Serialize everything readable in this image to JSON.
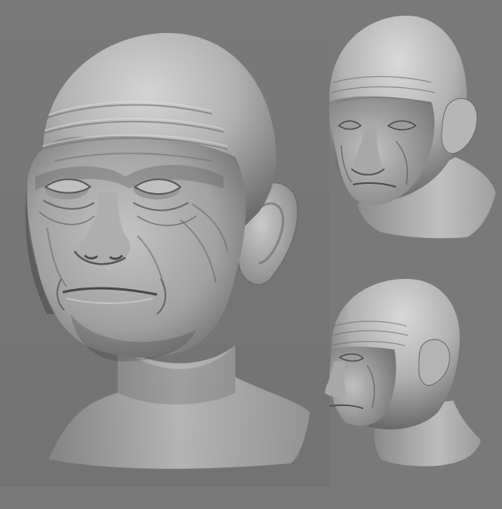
{
  "scene": {
    "background_color": "#797979",
    "sculpt_color": "#b9b9b9",
    "subject": "elderly-male-head-sculpt",
    "views": [
      "three-quarter-front",
      "three-quarter-top-left",
      "profile-left"
    ]
  }
}
